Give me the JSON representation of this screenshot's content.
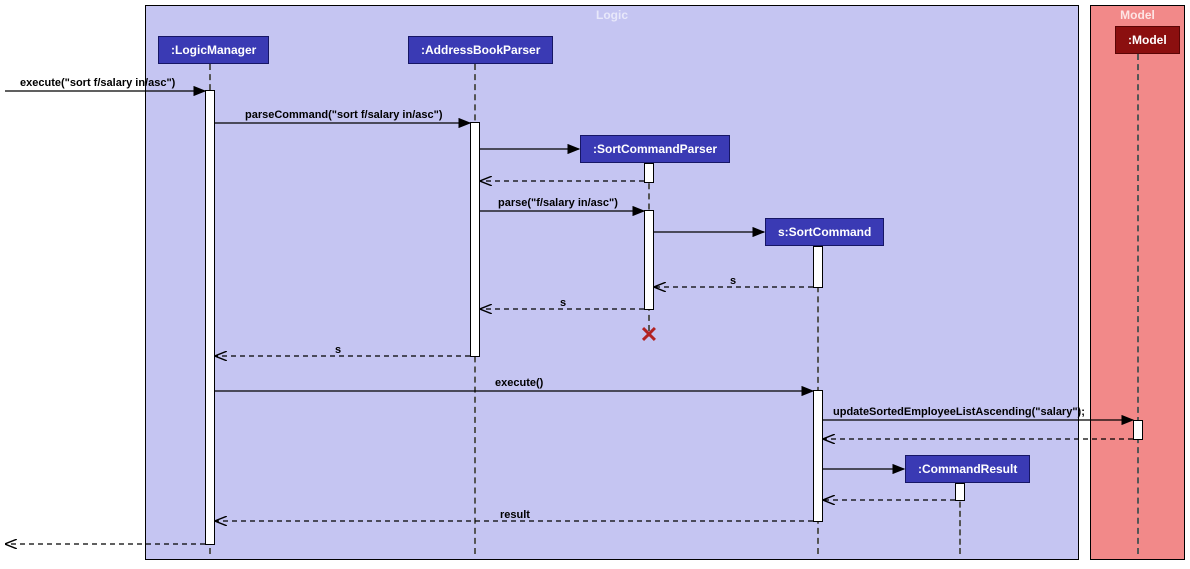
{
  "frames": {
    "logic": "Logic",
    "model": "Model"
  },
  "participants": {
    "logicManager": ":LogicManager",
    "addressBookParser": ":AddressBookParser",
    "sortCommandParser": ":SortCommandParser",
    "sortCommand": "s:SortCommand",
    "commandResult": ":CommandResult",
    "model": ":Model"
  },
  "messages": {
    "execute1": "execute(\"sort f/salary in/asc\")",
    "parseCommand": "parseCommand(\"sort f/salary in/asc\")",
    "parse": "parse(\"f/salary in/asc\")",
    "s1": "s",
    "s2": "s",
    "s3": "s",
    "execute2": "execute()",
    "updateSorted": "updateSortedEmployeeListAscending(\"salary\");",
    "result": "result"
  },
  "chart_data": {
    "type": "sequence-diagram",
    "frames": [
      {
        "name": "Logic",
        "participants": [
          ":LogicManager",
          ":AddressBookParser",
          ":SortCommandParser",
          "s:SortCommand",
          ":CommandResult"
        ]
      },
      {
        "name": "Model",
        "participants": [
          ":Model"
        ]
      }
    ],
    "interactions": [
      {
        "from": "caller",
        "to": ":LogicManager",
        "type": "sync",
        "label": "execute(\"sort f/salary in/asc\")"
      },
      {
        "from": ":LogicManager",
        "to": ":AddressBookParser",
        "type": "sync",
        "label": "parseCommand(\"sort f/salary in/asc\")"
      },
      {
        "from": ":AddressBookParser",
        "to": ":SortCommandParser",
        "type": "create",
        "label": ""
      },
      {
        "from": ":SortCommandParser",
        "to": ":AddressBookParser",
        "type": "return",
        "label": ""
      },
      {
        "from": ":AddressBookParser",
        "to": ":SortCommandParser",
        "type": "sync",
        "label": "parse(\"f/salary in/asc\")"
      },
      {
        "from": ":SortCommandParser",
        "to": "s:SortCommand",
        "type": "create",
        "label": ""
      },
      {
        "from": "s:SortCommand",
        "to": ":SortCommandParser",
        "type": "return",
        "label": "s"
      },
      {
        "from": ":SortCommandParser",
        "to": ":AddressBookParser",
        "type": "return",
        "label": "s"
      },
      {
        "from": ":SortCommandParser",
        "to": "",
        "type": "destroy",
        "label": ""
      },
      {
        "from": ":AddressBookParser",
        "to": ":LogicManager",
        "type": "return",
        "label": "s"
      },
      {
        "from": ":LogicManager",
        "to": "s:SortCommand",
        "type": "sync",
        "label": "execute()"
      },
      {
        "from": "s:SortCommand",
        "to": ":Model",
        "type": "sync",
        "label": "updateSortedEmployeeListAscending(\"salary\");"
      },
      {
        "from": ":Model",
        "to": "s:SortCommand",
        "type": "return",
        "label": ""
      },
      {
        "from": "s:SortCommand",
        "to": ":CommandResult",
        "type": "create",
        "label": ""
      },
      {
        "from": ":CommandResult",
        "to": "s:SortCommand",
        "type": "return",
        "label": ""
      },
      {
        "from": "s:SortCommand",
        "to": ":LogicManager",
        "type": "return",
        "label": "result"
      },
      {
        "from": ":LogicManager",
        "to": "caller",
        "type": "return",
        "label": ""
      }
    ]
  }
}
